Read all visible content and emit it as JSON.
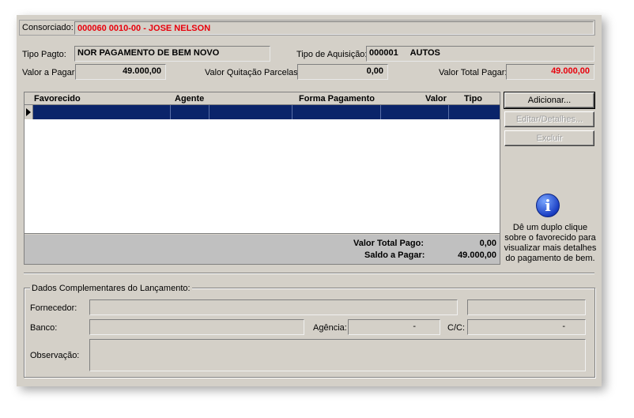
{
  "consorciado": {
    "label": "Consorciado:",
    "value": "000060 0010-00 - JOSE NELSON"
  },
  "tipo_pagto": {
    "label": "Tipo Pagto:",
    "value": "NOR  PAGAMENTO DE BEM NOVO"
  },
  "tipo_aquisicao": {
    "label": "Tipo de Aquisição:",
    "value": "000001     AUTOS"
  },
  "valor_pagar": {
    "label": "Valor a Pagar:",
    "value": "49.000,00"
  },
  "valor_quitacao": {
    "label": "Valor Quitação Parcelas:",
    "value": "0,00"
  },
  "valor_total_pagar": {
    "label": "Valor Total Pagar:",
    "value": "49.000,00"
  },
  "grid": {
    "columns": [
      "Favorecido",
      "Agente",
      "Forma Pagamento",
      "Valor",
      "Tipo"
    ],
    "totals": {
      "pago_label": "Valor Total Pago:",
      "pago_value": "0,00",
      "saldo_label": "Saldo a Pagar:",
      "saldo_value": "49.000,00"
    }
  },
  "buttons": {
    "adicionar": "Adicionar...",
    "editar": "Editar/Detalhes...",
    "excluir": "Excluir"
  },
  "info": {
    "icon": "info-icon",
    "text": "Dê um duplo clique sobre o favorecido para visualizar mais detalhes do pagamento de bem."
  },
  "complementares": {
    "legend": "Dados Complementares do Lançamento:",
    "fornecedor_label": "Fornecedor:",
    "banco_label": "Banco:",
    "agencia_label": "Agência:",
    "agencia_value": "-",
    "cc_label": "C/C:",
    "cc_value": "-",
    "observacao_label": "Observação:"
  },
  "colors": {
    "accent_red": "#e8000c",
    "selection": "#0a246a",
    "face": "#d4d0c8"
  }
}
